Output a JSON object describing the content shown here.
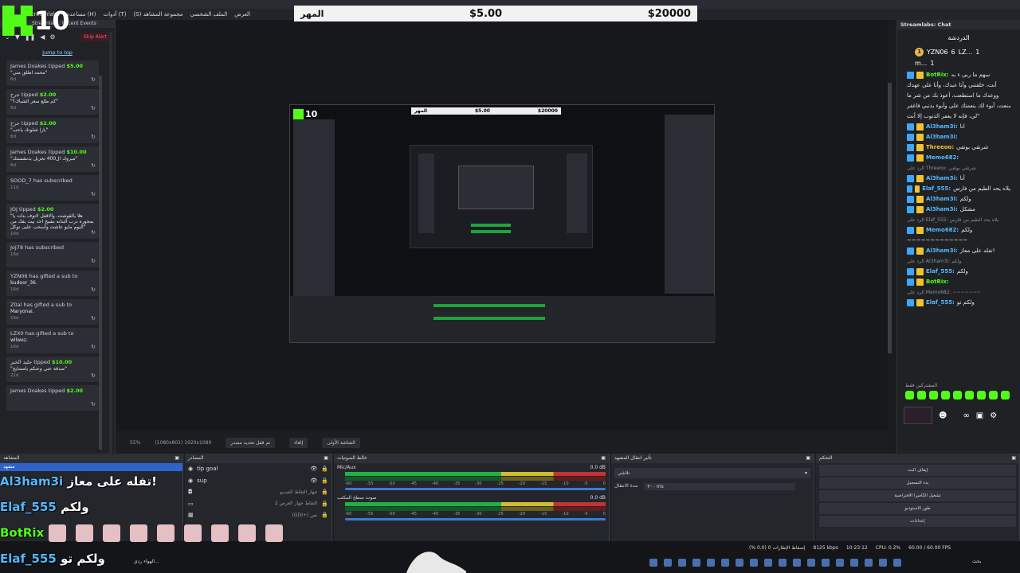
{
  "menubar": {
    "items": [
      "Streamlabs",
      "مساعدة (H)",
      "أدوات (T)",
      "(S) مجموعة المشاهد",
      "الملف الشخصي",
      "العرض"
    ]
  },
  "logo": {
    "letter": "K",
    "number": "10"
  },
  "goal": {
    "label": "المهر",
    "current": "$5.00",
    "target": "$20000"
  },
  "left_dock": {
    "header": "Streamlabs: Recent Events",
    "skip": "Skip Alert",
    "jump": "Jump to top",
    "events": [
      {
        "user": "James Doakes",
        "verb": "tipped",
        "amount": "$5.00",
        "msg": "\"محمد اطلق مني\"",
        "age": "6d"
      },
      {
        "user": "جرح",
        "verb": "tipped",
        "amount": "$2.00",
        "msg": "\"كم طلع سعر الشباك؟\"",
        "age": "6d"
      },
      {
        "user": "جرح",
        "verb": "tipped",
        "amount": "$2.00",
        "msg": "\"يارا شلونك ياحب\"",
        "age": "6d"
      },
      {
        "user": "James Doakes",
        "verb": "tipped",
        "amount": "$10.00",
        "msg": "\"مبروك ال400 تحزيل بدنشستك\"",
        "age": "6d"
      },
      {
        "user": "SOOD_7",
        "verb": "has subscribed",
        "amount": "",
        "msg": "",
        "age": "11d"
      },
      {
        "user": "JOJ",
        "verb": "tipped",
        "amount": "$2.00",
        "msg": "\"هلا يالقوشت، والاقفل لاتوف بنات يا بمجوره درب البنانه بشيخ احد بيت يفك من اليوم مايو عاشت وأسحب عليى توكل\"",
        "age": "16d"
      },
      {
        "user": "JoJ78",
        "verb": "has subscribed",
        "amount": "",
        "msg": "",
        "age": "16d"
      },
      {
        "user": "YZN06",
        "verb": "has gifted a sub to",
        "amount": "",
        "msg": "budoor_36.",
        "age": "16d"
      },
      {
        "user": "Z0al",
        "verb": "has gifted a sub to",
        "amount": "",
        "msg": "Maryonai.",
        "age": "16d"
      },
      {
        "user": "LZX0",
        "verb": "has gifted a sub to",
        "amount": "",
        "msg": "wllwez.",
        "age": "16d"
      },
      {
        "user": "جليد الخير",
        "verb": "tipped",
        "amount": "$10.00",
        "msg": "\"صدقة عني وعنكم يامسايح\"",
        "age": "21d"
      },
      {
        "user": "James Doakes",
        "verb": "tipped",
        "amount": "$2.00",
        "msg": "",
        "age": ""
      }
    ]
  },
  "right_dock": {
    "header": "Streamlabs: Chat",
    "title": "الدردشة",
    "leaders": [
      {
        "rank": "1",
        "name": "YZN06",
        "count": "6"
      },
      {
        "rank": "",
        "name": "LZ...",
        "count": "1"
      },
      {
        "rank": "",
        "name": "m...",
        "count": "1"
      }
    ],
    "chat": [
      {
        "u": "BotRix:",
        "t": "سهم ما ربي ء به"
      },
      {
        "u": "",
        "t": "أنت، خلقتني وأنا عبدك، وأنا على عهدك"
      },
      {
        "u": "",
        "t": "ووعدك ما استطعت، أعوذ بك من شر ما"
      },
      {
        "u": "",
        "t": "صنعت، أبوء لك بنعمتك علي وأبوء بذنبي فاغفر"
      },
      {
        "u": "",
        "t": "لي، فإنه لا يغفر الذنوب إلا أنت\""
      },
      {
        "u": "Al3ham3i:",
        "t": "انا"
      },
      {
        "u": "Al3ham3i:",
        "t": ""
      },
      {
        "u": "Threeoo:",
        "t": "شرتقي بوتقي"
      },
      {
        "u": "Memo682:",
        "t": ""
      },
      {
        "u": "",
        "t": "الرد على Threeoo: شرتقي بوتقي",
        "sub": true
      },
      {
        "u": "Al3ham3i:",
        "t": "أنا"
      },
      {
        "u": "Elaf_555:",
        "t": "يلاه يحد الطيم من فارس"
      },
      {
        "u": "Al3ham3i:",
        "t": "ولكم"
      },
      {
        "u": "Al3ham3i:",
        "t": "مشكل"
      },
      {
        "u": "",
        "t": "الرد على Elaf_555: يلاه يحد الطيم من فارس",
        "sub": true
      },
      {
        "u": "Memo682:",
        "t": "ولكم"
      },
      {
        "u": "",
        "t": "~~~~~~~~~~~~~"
      },
      {
        "u": "Al3ham3i:",
        "t": "تفله على معاز!"
      },
      {
        "u": "",
        "t": "الرد على Al3ham3i: ولكم",
        "sub": true
      },
      {
        "u": "Elaf_555:",
        "t": "ولكم"
      },
      {
        "u": "BotRix:",
        "t": ""
      },
      {
        "u": "",
        "t": "الرد على Memo682: ~~~~~~~",
        "sub": true
      },
      {
        "u": "Elaf_555:",
        "t": "ولكم تو"
      }
    ],
    "subs_label": "المشتركين فقط"
  },
  "midstrip": {
    "zoom": "55%",
    "res": "(1080x801) 1920x1080",
    "b1": "إلغاء",
    "b2": "الشاشة الأولى",
    "b3": "تم قفل تحديد مصدر"
  },
  "docks": {
    "scenes": {
      "title": "المشاهد",
      "selected": "مشهد"
    },
    "sources": {
      "title": "المصادر",
      "items": [
        "tip goal",
        "sup",
        "جهاز التقاط الفيديو",
        "التقاط جهاز العرض 2",
        "(GDI+) نص"
      ]
    },
    "mixer": {
      "title": "خالط الصوتيات",
      "ch1": "Mic/Aux",
      "ch2": "صوت سطح المكتب",
      "db": "0.0 dB",
      "scale": [
        "-60",
        "-55",
        "-50",
        "-45",
        "-40",
        "-35",
        "-30",
        "-25",
        "-20",
        "-15",
        "-10",
        "-5",
        "0"
      ]
    },
    "transitions": {
      "title": "تأثير انتقال المشهد",
      "type": "تلاشي",
      "dur_label": "مدة الانتقال",
      "dur": "٣٠٠ ms"
    },
    "controls": {
      "title": "التحكم",
      "buttons": [
        "إيقاف البث",
        "بدء التسجيل",
        "تشغيل الكاميرا الافتراضية",
        "طور الاستوديو",
        "إعدادات"
      ]
    }
  },
  "overlay_chat": [
    {
      "user": "Al3ham3i",
      "text": "تفله على معاز!"
    },
    {
      "user": "Elaf_555",
      "text": "ولكم"
    },
    {
      "user": "BotRix",
      "text": ""
    },
    {
      "user": "Elaf_555",
      "text": "ولكم تو"
    }
  ],
  "status": {
    "dropped": "إسقاط الإطارات 0 (0.0 %)",
    "kbps": "8125 kbps",
    "time": "10:23:12",
    "cpu": "CPU: 0.2%",
    "fps": "60.00 / 60.00 FPS"
  },
  "taskbar": {
    "weather": "الهواء ردي...",
    "search": "بحث"
  }
}
